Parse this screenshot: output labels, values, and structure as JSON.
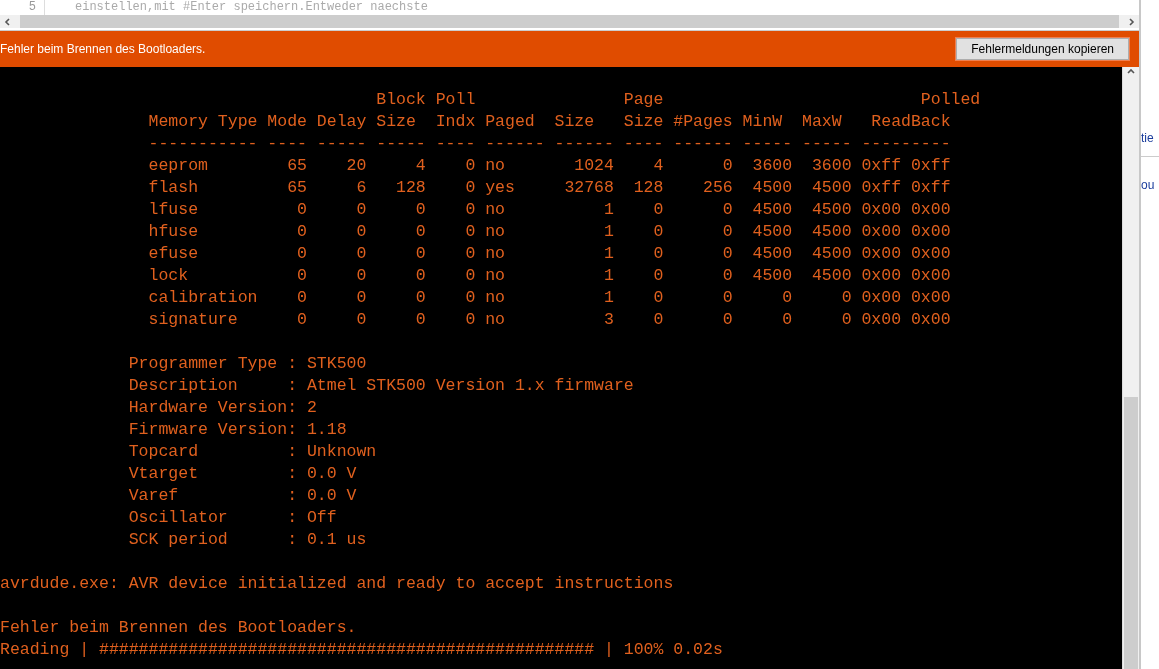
{
  "editor": {
    "line_number": "5",
    "code": "einstellen,mit #Enter speichern.Entweder naechste"
  },
  "status_bar": {
    "message": "Fehler beim Brennen des Bootloaders.",
    "button": "Fehlermeldungen kopieren"
  },
  "console": {
    "blocks": [
      {
        "lines": [
          "                                      Block Poll               Page                          Polled",
          "               Memory Type Mode Delay Size  Indx Paged  Size   Size #Pages MinW  MaxW   ReadBack",
          "               ----------- ---- ----- ----- ---- ------ ------ ---- ------ ----- ----- ---------",
          "               eeprom        65    20     4    0 no       1024    4      0  3600  3600 0xff 0xff",
          "               flash         65     6   128    0 yes     32768  128    256  4500  4500 0xff 0xff",
          "               lfuse          0     0     0    0 no          1    0      0  4500  4500 0x00 0x00",
          "               hfuse          0     0     0    0 no          1    0      0  4500  4500 0x00 0x00",
          "               efuse          0     0     0    0 no          1    0      0  4500  4500 0x00 0x00",
          "               lock           0     0     0    0 no          1    0      0  4500  4500 0x00 0x00",
          "               calibration    0     0     0    0 no          1    0      0     0     0 0x00 0x00",
          "               signature      0     0     0    0 no          3    0      0     0     0 0x00 0x00"
        ]
      },
      {
        "lines": [
          "             Programmer Type : STK500",
          "             Description     : Atmel STK500 Version 1.x firmware",
          "             Hardware Version: 2",
          "             Firmware Version: 1.18",
          "             Topcard         : Unknown",
          "             Vtarget         : 0.0 V",
          "             Varef           : 0.0 V",
          "             Oscillator      : Off",
          "             SCK period      : 0.1 us"
        ]
      },
      {
        "lines": [
          "avrdude.exe: AVR device initialized and ready to accept instructions"
        ]
      },
      {
        "lines": [
          "Fehler beim Brennen des Bootloaders.",
          "Reading | ################################################## | 100% 0.02s"
        ]
      }
    ]
  },
  "side_window": {
    "fragments": [
      "tie",
      "ou"
    ]
  }
}
